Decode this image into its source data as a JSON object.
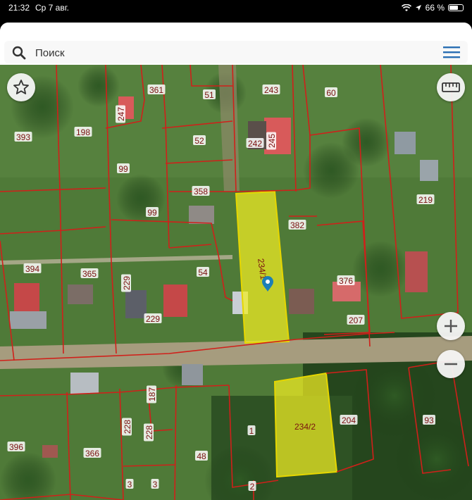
{
  "status": {
    "time": "21:32",
    "date": "Ср 7 авг.",
    "battery": "66 %",
    "battery_level": 0.66
  },
  "search": {
    "placeholder": "Поиск"
  },
  "map": {
    "colors": {
      "boundary": "#d0201a",
      "highlight": "#f2ee22",
      "highlight_border": "#e6d600"
    },
    "highlighted_plots": [
      "234/1",
      "234/2"
    ],
    "plots": [
      "361",
      "51",
      "243",
      "60",
      "247",
      "393",
      "198",
      "52",
      "242",
      "245",
      "99",
      "99",
      "358",
      "219",
      "382",
      "394",
      "365",
      "229",
      "54",
      "234/1",
      "376",
      "229",
      "207",
      "187",
      "228",
      "228",
      "1",
      "234/2",
      "204",
      "93",
      "396",
      "366",
      "48",
      "3",
      "3",
      "2"
    ]
  },
  "controls": {
    "favorite_icon": "star-icon",
    "measure_icon": "ruler-icon",
    "zoom_in_icon": "plus-icon",
    "zoom_out_icon": "minus-icon"
  }
}
